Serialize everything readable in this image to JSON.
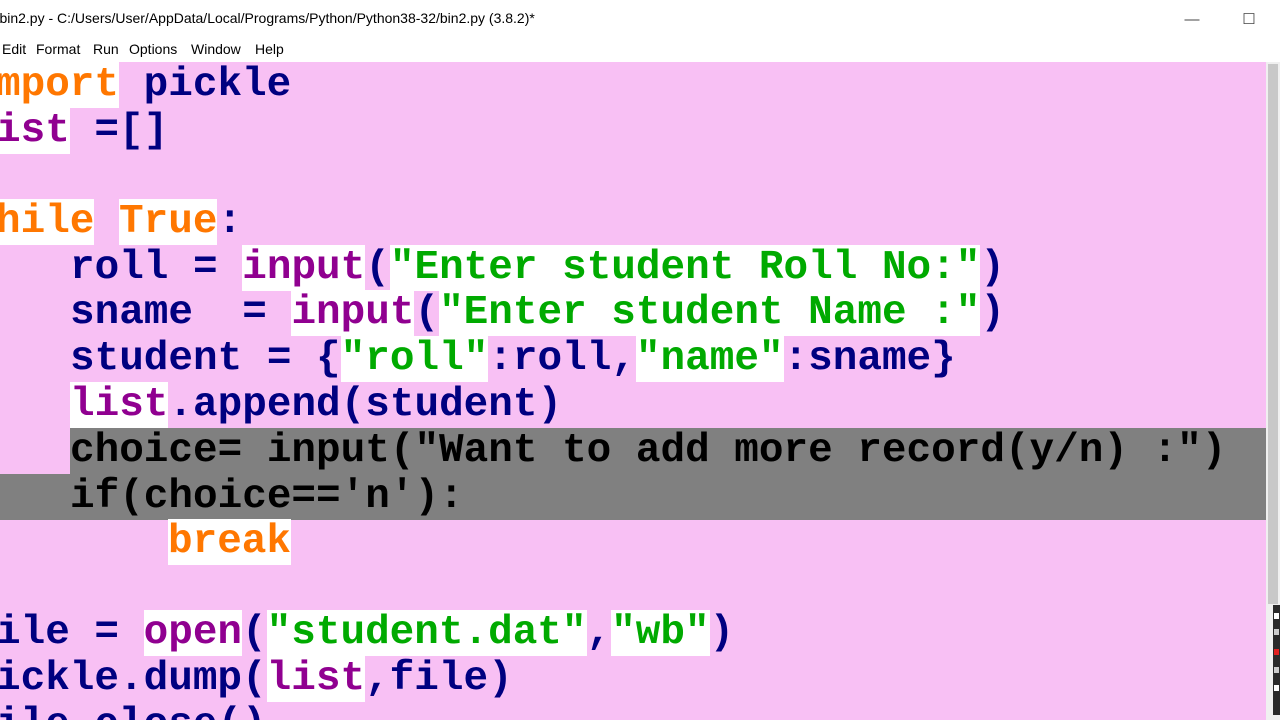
{
  "window": {
    "title": "*bin2.py - C:/Users/User/AppData/Local/Programs/Python/Python38-32/bin2.py (3.8.2)*",
    "minimize_glyph": "—",
    "maximize_glyph": "☐"
  },
  "menu": [
    "Edit",
    "Format",
    "Run",
    "Options",
    "Window",
    "Help"
  ],
  "code": {
    "line1": {
      "kw": "mport",
      "rest": " pickle"
    },
    "line2": {
      "bi": "ist",
      "rest": " =[]"
    },
    "line4": {
      "kw1": "hile",
      "kw2": "True",
      "rest": ":"
    },
    "line5": {
      "pre": "roll = ",
      "bi": "input",
      "p1": "(",
      "st": "\"Enter student Roll No:\"",
      "p2": ")"
    },
    "line6": {
      "pre": "sname  = ",
      "bi": "input",
      "p1": "(",
      "st": "\"Enter student Name :\"",
      "p2": ")"
    },
    "line7": {
      "pre": "student = {",
      "st1": "\"roll\"",
      "mid": ":roll,",
      "st2": "\"name\"",
      "post": ":sname}"
    },
    "line8": {
      "bi": "list",
      "rest": ".append(student)"
    },
    "line9": {
      "text": "choice= input(\"Want to add more record(y/n) :\")"
    },
    "line10": {
      "text": "if(choice=='n'):"
    },
    "line11": {
      "kw": "break"
    },
    "line13": {
      "pre": "ile = ",
      "bi": "open",
      "p1": "(",
      "st1": "\"student.dat\"",
      "comma": ",",
      "st2": "\"wb\"",
      "p2": ")"
    },
    "line14": {
      "pre": "ickle.dump(",
      "bi": "list",
      "rest": ",file)"
    },
    "line15": {
      "text": "ile.close()"
    }
  },
  "colors": {
    "editor_bg": "#f8c0f4",
    "keyword": "#ff7700",
    "builtin": "#900090",
    "string": "#00aa00",
    "default": "#000080",
    "selection": "#808080"
  }
}
